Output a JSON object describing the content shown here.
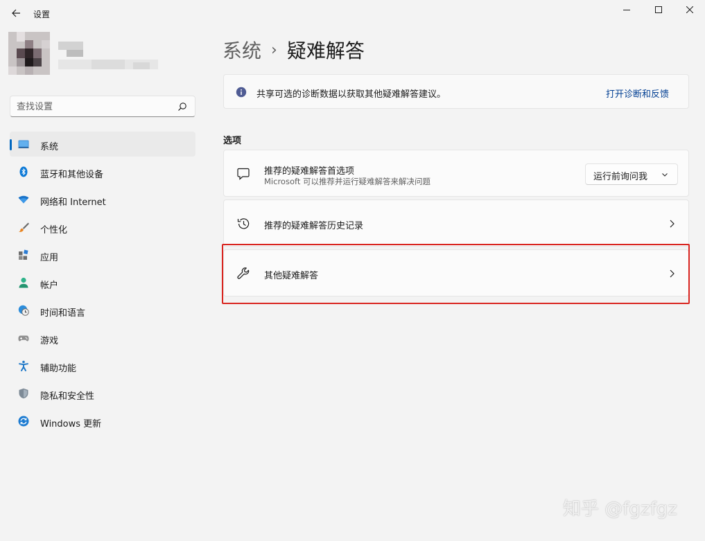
{
  "window": {
    "title": "设置"
  },
  "search": {
    "placeholder": "查找设置"
  },
  "sidebar": {
    "items": [
      {
        "label": "系统",
        "icon": "monitor-icon",
        "active": true
      },
      {
        "label": "蓝牙和其他设备",
        "icon": "bluetooth-icon"
      },
      {
        "label": "网络和 Internet",
        "icon": "wifi-icon"
      },
      {
        "label": "个性化",
        "icon": "brush-icon"
      },
      {
        "label": "应用",
        "icon": "apps-icon"
      },
      {
        "label": "帐户",
        "icon": "person-icon"
      },
      {
        "label": "时间和语言",
        "icon": "globe-clock-icon"
      },
      {
        "label": "游戏",
        "icon": "gamepad-icon"
      },
      {
        "label": "辅助功能",
        "icon": "accessibility-icon"
      },
      {
        "label": "隐私和安全性",
        "icon": "shield-icon"
      },
      {
        "label": "Windows 更新",
        "icon": "update-icon"
      }
    ]
  },
  "breadcrumb": {
    "parent": "系统",
    "separator": "›",
    "current": "疑难解答"
  },
  "banner": {
    "text": "共享可选的诊断数据以获取其他疑难解答建议。",
    "link": "打开诊断和反馈"
  },
  "section": {
    "title": "选项"
  },
  "cards": {
    "recommended_prefs": {
      "title": "推荐的疑难解答首选项",
      "description": "Microsoft 可以推荐并运行疑难解答来解决问题",
      "dropdown_value": "运行前询问我"
    },
    "history": {
      "title": "推荐的疑难解答历史记录"
    },
    "other": {
      "title": "其他疑难解答"
    }
  },
  "watermark": "知乎 @fgzfgz",
  "colors": {
    "accent": "#0067c0",
    "highlight": "#d9241f",
    "link": "#003e92"
  }
}
